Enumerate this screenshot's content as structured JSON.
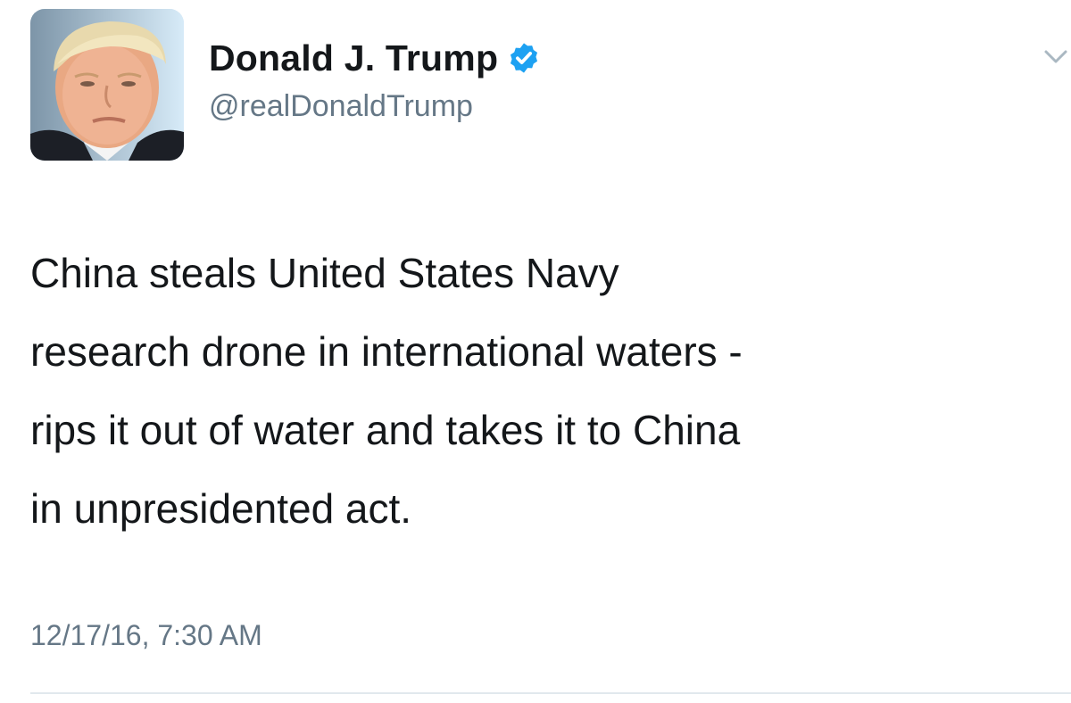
{
  "author": {
    "display_name": "Donald J. Trump",
    "handle": "@realDonaldTrump",
    "verified": true,
    "avatar_icon": "profile-photo"
  },
  "tweet": {
    "lines": [
      "China steals United States Navy",
      "research drone in international waters -",
      "rips it out of water and takes it to China",
      "in unpresidented act."
    ],
    "timestamp": "12/17/16, 7:30 AM"
  },
  "icons": {
    "verified": "verified-badge-icon",
    "menu": "chevron-down-icon"
  },
  "colors": {
    "verified_blue": "#1da1f2",
    "secondary_text": "#657786",
    "primary_text": "#14171a",
    "divider": "#e1e8ed"
  }
}
